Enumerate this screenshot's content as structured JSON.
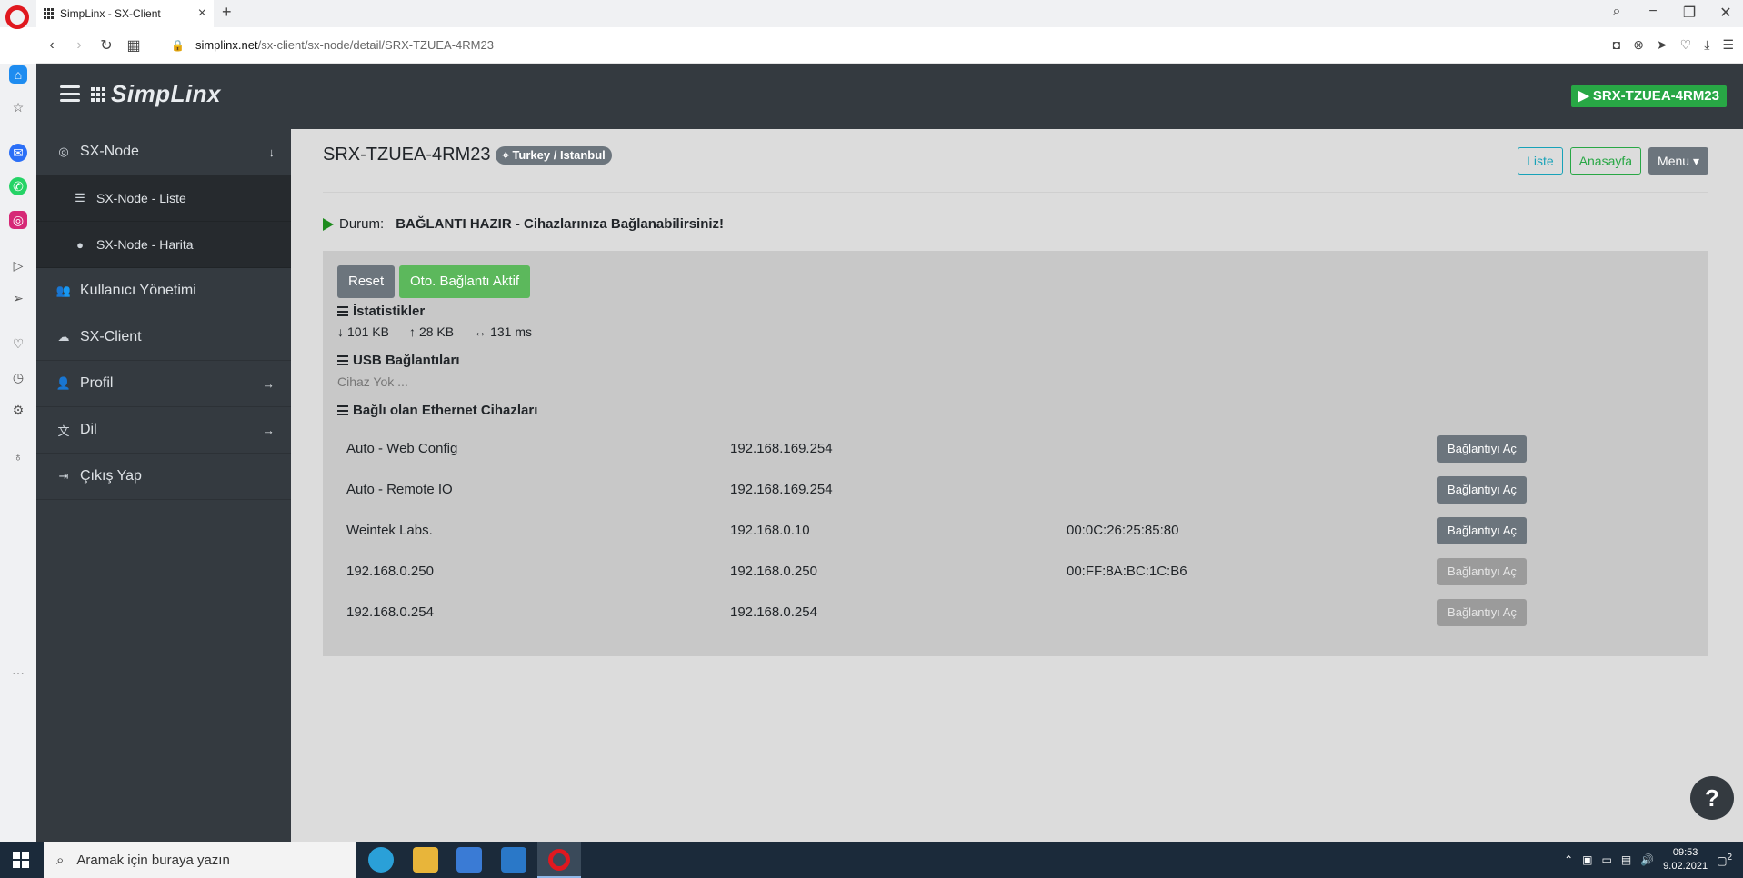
{
  "browser": {
    "tab_title": "SimpLinx - SX-Client",
    "url_host": "simplinx.net",
    "url_path": "/sx-client/sx-node/detail/SRX-TZUEA-4RM23"
  },
  "header": {
    "brand": "SimpLinx",
    "node_badge": "SRX-TZUEA-4RM23"
  },
  "sidebar": {
    "items": [
      {
        "label": "SX-Node",
        "icon": "target-icon"
      },
      {
        "label": "SX-Node - Liste",
        "icon": "list-icon"
      },
      {
        "label": "SX-Node - Harita",
        "icon": "globe-icon"
      },
      {
        "label": "Kullanıcı Yönetimi",
        "icon": "users-icon"
      },
      {
        "label": "SX-Client",
        "icon": "cloud-download-icon"
      },
      {
        "label": "Profil",
        "icon": "user-icon"
      },
      {
        "label": "Dil",
        "icon": "language-icon"
      },
      {
        "label": "Çıkış Yap",
        "icon": "sign-out-icon"
      }
    ]
  },
  "main": {
    "title": "SRX-TZUEA-4RM23",
    "location": "Turkey / Istanbul",
    "buttons": {
      "liste": "Liste",
      "anasayfa": "Anasayfa",
      "menu": "Menu"
    },
    "status_label": "Durum:",
    "status_text": "BAĞLANTI HAZIR - Cihazlarınıza Bağlanabilirsiniz!",
    "reset_label": "Reset",
    "auto_label": "Oto. Bağlantı Aktif",
    "stats_heading": "İstatistikler",
    "stats": {
      "download": "101 KB",
      "upload": "28 KB",
      "latency": "131 ms"
    },
    "usb_heading": "USB Bağlantıları",
    "usb_empty": "Cihaz Yok ...",
    "eth_heading": "Bağlı olan Ethernet Cihazları",
    "devices": [
      {
        "name": "Auto - Web Config",
        "ip": "192.168.169.254",
        "mac": "",
        "button": "Bağlantıyı Aç",
        "enabled": true
      },
      {
        "name": "Auto - Remote IO",
        "ip": "192.168.169.254",
        "mac": "",
        "button": "Bağlantıyı Aç",
        "enabled": true
      },
      {
        "name": "Weintek Labs.",
        "ip": "192.168.0.10",
        "mac": "00:0C:26:25:85:80",
        "button": "Bağlantıyı Aç",
        "enabled": true
      },
      {
        "name": "192.168.0.250",
        "ip": "192.168.0.250",
        "mac": "00:FF:8A:BC:1C:B6",
        "button": "Bağlantıyı Aç",
        "enabled": false
      },
      {
        "name": "192.168.0.254",
        "ip": "192.168.0.254",
        "mac": "",
        "button": "Bağlantıyı Aç",
        "enabled": false
      }
    ],
    "help": "?"
  },
  "taskbar": {
    "search_placeholder": "Aramak için buraya yazın",
    "time": "09:53",
    "date": "9.02.2021",
    "notifications": "2"
  },
  "colors": {
    "header_bg": "#343a40",
    "success": "#28a745",
    "info": "#17a2b8",
    "secondary": "#6c757d"
  }
}
